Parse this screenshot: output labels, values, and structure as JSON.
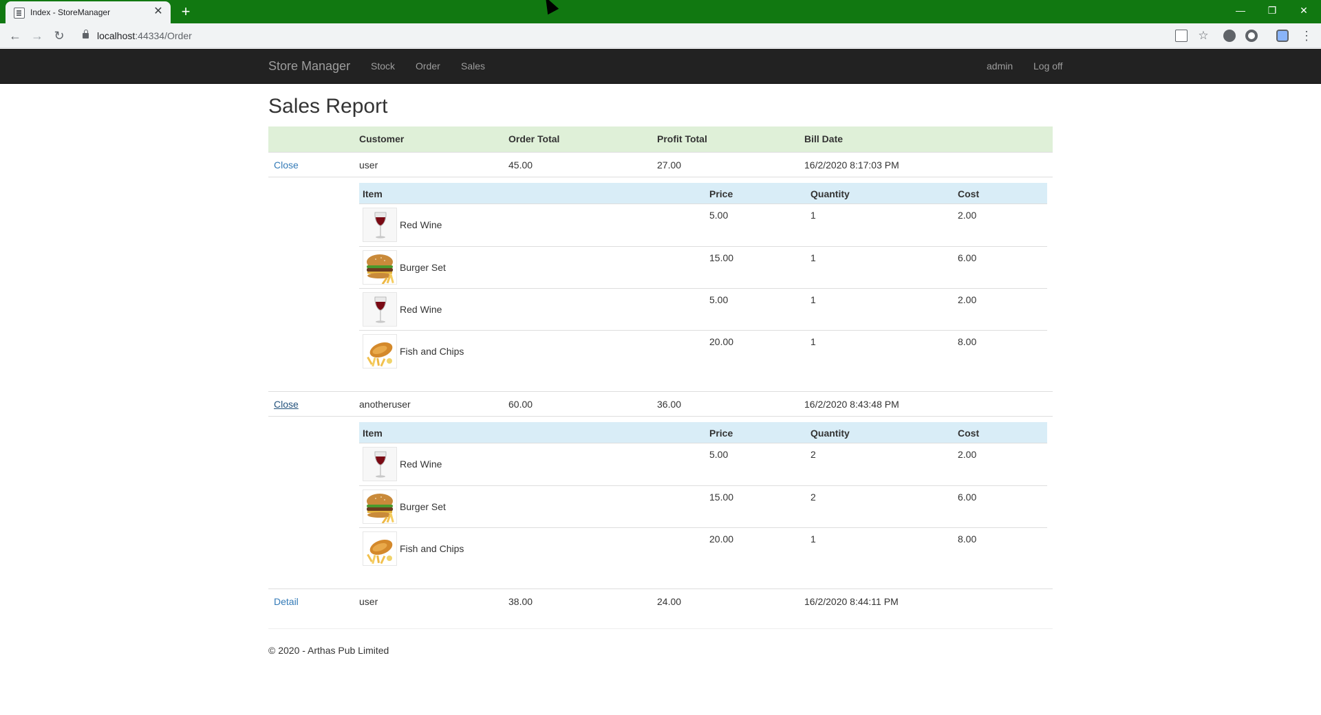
{
  "browser": {
    "tab_title": "Index - StoreManager",
    "tab_close": "✕",
    "new_tab": "+",
    "url_host": "localhost",
    "url_rest": ":44334/Order",
    "window_controls": {
      "minimize": "—",
      "restore": "❐",
      "close": "✕"
    },
    "nav": {
      "back": "←",
      "forward": "→",
      "reload": "↻"
    },
    "star": "☆",
    "menu": "⋮"
  },
  "navbar": {
    "brand": "Store Manager",
    "links": [
      "Stock",
      "Order",
      "Sales"
    ],
    "user": "admin",
    "logoff": "Log off"
  },
  "page": {
    "title": "Sales Report"
  },
  "report": {
    "headers": {
      "customer": "Customer",
      "order_total": "Order Total",
      "profit_total": "Profit Total",
      "bill_date": "Bill Date"
    },
    "detail_headers": {
      "item": "Item",
      "price": "Price",
      "quantity": "Quantity",
      "cost": "Cost"
    },
    "orders": [
      {
        "action": "Close",
        "customer": "user",
        "order_total": "45.00",
        "profit_total": "27.00",
        "bill_date": "16/2/2020 8:17:03 PM",
        "items": [
          {
            "name": "Red Wine",
            "icon": "wine-glass-icon",
            "price": "5.00",
            "quantity": "1",
            "cost": "2.00"
          },
          {
            "name": "Burger Set",
            "icon": "burger-icon",
            "price": "15.00",
            "quantity": "1",
            "cost": "6.00"
          },
          {
            "name": "Red Wine",
            "icon": "wine-glass-icon",
            "price": "5.00",
            "quantity": "1",
            "cost": "2.00"
          },
          {
            "name": "Fish and Chips",
            "icon": "fish-and-chips-icon",
            "price": "20.00",
            "quantity": "1",
            "cost": "8.00"
          }
        ]
      },
      {
        "action": "Close",
        "customer": "anotheruser",
        "order_total": "60.00",
        "profit_total": "36.00",
        "bill_date": "16/2/2020 8:43:48 PM",
        "items": [
          {
            "name": "Red Wine",
            "icon": "wine-glass-icon",
            "price": "5.00",
            "quantity": "2",
            "cost": "2.00"
          },
          {
            "name": "Burger Set",
            "icon": "burger-icon",
            "price": "15.00",
            "quantity": "2",
            "cost": "6.00"
          },
          {
            "name": "Fish and Chips",
            "icon": "fish-and-chips-icon",
            "price": "20.00",
            "quantity": "1",
            "cost": "8.00"
          }
        ]
      },
      {
        "action": "Detail",
        "customer": "user",
        "order_total": "38.00",
        "profit_total": "24.00",
        "bill_date": "16/2/2020 8:44:11 PM",
        "items": []
      }
    ]
  },
  "footer": {
    "text": "© 2020 - Arthas Pub Limited"
  },
  "colors": {
    "title_bar": "#117811",
    "navbar": "#222222",
    "header_row": "#dff0d8",
    "detail_header": "#d9edf7",
    "link": "#337ab7"
  }
}
